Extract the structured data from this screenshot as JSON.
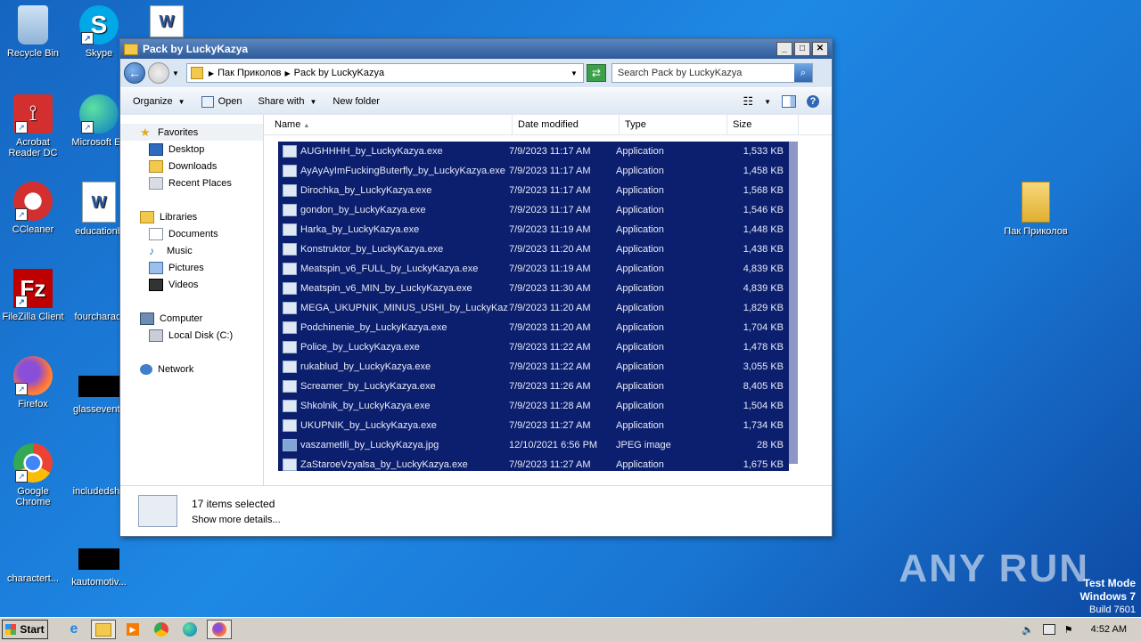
{
  "desktop": {
    "icons": [
      {
        "label": "Recycle Bin"
      },
      {
        "label": "Skype"
      },
      {
        "label": "Acrobat Reader DC"
      },
      {
        "label": "Microsoft Ed"
      },
      {
        "label": "CCleaner"
      },
      {
        "label": "educationb"
      },
      {
        "label": "FileZilla Client"
      },
      {
        "label": "fourcharact"
      },
      {
        "label": "Firefox"
      },
      {
        "label": "glassevents"
      },
      {
        "label": "Google Chrome"
      },
      {
        "label": "includedsha"
      },
      {
        "label": "charactert..."
      },
      {
        "label": "kautomotiv..."
      },
      {
        "label": "Пак Приколов"
      }
    ]
  },
  "window": {
    "title": "Pack by LuckyKazya",
    "address": {
      "segments": [
        "Пак Приколов",
        "Pack by LuckyKazya"
      ]
    },
    "search_placeholder": "Search Pack by LuckyKazya",
    "toolbar": {
      "organize": "Organize",
      "open": "Open",
      "share": "Share with",
      "new_folder": "New folder"
    },
    "nav": {
      "favorites": "Favorites",
      "desktop": "Desktop",
      "downloads": "Downloads",
      "recent": "Recent Places",
      "libraries": "Libraries",
      "documents": "Documents",
      "music": "Music",
      "pictures": "Pictures",
      "videos": "Videos",
      "computer": "Computer",
      "local_disk": "Local Disk (C:)",
      "network": "Network"
    },
    "columns": {
      "name": "Name",
      "date": "Date modified",
      "type": "Type",
      "size": "Size"
    },
    "files": [
      {
        "name": "AUGHHHH_by_LuckyKazya.exe",
        "date": "7/9/2023 11:17 AM",
        "type": "Application",
        "size": "1,533 KB"
      },
      {
        "name": "AyAyAyImFuckingButerfly_by_LuckyKazya.exe",
        "date": "7/9/2023 11:17 AM",
        "type": "Application",
        "size": "1,458 KB"
      },
      {
        "name": "Dirochka_by_LuckyKazya.exe",
        "date": "7/9/2023 11:17 AM",
        "type": "Application",
        "size": "1,568 KB"
      },
      {
        "name": "gondon_by_LuckyKazya.exe",
        "date": "7/9/2023 11:17 AM",
        "type": "Application",
        "size": "1,546 KB"
      },
      {
        "name": "Harka_by_LuckyKazya.exe",
        "date": "7/9/2023 11:19 AM",
        "type": "Application",
        "size": "1,448 KB"
      },
      {
        "name": "Konstruktor_by_LuckyKazya.exe",
        "date": "7/9/2023 11:20 AM",
        "type": "Application",
        "size": "1,438 KB"
      },
      {
        "name": "Meatspin_v6_FULL_by_LuckyKazya.exe",
        "date": "7/9/2023 11:19 AM",
        "type": "Application",
        "size": "4,839 KB"
      },
      {
        "name": "Meatspin_v6_MIN_by_LuckyKazya.exe",
        "date": "7/9/2023 11:30 AM",
        "type": "Application",
        "size": "4,839 KB"
      },
      {
        "name": "MEGA_UKUPNIK_MINUS_USHI_by_LuckyKaz...",
        "date": "7/9/2023 11:20 AM",
        "type": "Application",
        "size": "1,829 KB"
      },
      {
        "name": "Podchinenie_by_LuckyKazya.exe",
        "date": "7/9/2023 11:20 AM",
        "type": "Application",
        "size": "1,704 KB"
      },
      {
        "name": "Police_by_LuckyKazya.exe",
        "date": "7/9/2023 11:22 AM",
        "type": "Application",
        "size": "1,478 KB"
      },
      {
        "name": "rukablud_by_LuckyKazya.exe",
        "date": "7/9/2023 11:22 AM",
        "type": "Application",
        "size": "3,055 KB"
      },
      {
        "name": "Screamer_by_LuckyKazya.exe",
        "date": "7/9/2023 11:26 AM",
        "type": "Application",
        "size": "8,405 KB"
      },
      {
        "name": "Shkolnik_by_LuckyKazya.exe",
        "date": "7/9/2023 11:28 AM",
        "type": "Application",
        "size": "1,504 KB"
      },
      {
        "name": "UKUPNIK_by_LuckyKazya.exe",
        "date": "7/9/2023 11:27 AM",
        "type": "Application",
        "size": "1,734 KB"
      },
      {
        "name": "vaszametili_by_LuckyKazya.jpg",
        "date": "12/10/2021 6:56 PM",
        "type": "JPEG image",
        "size": "28 KB"
      },
      {
        "name": "ZaStaroeVzyalsa_by_LuckyKazya.exe",
        "date": "7/9/2023 11:27 AM",
        "type": "Application",
        "size": "1,675 KB"
      }
    ],
    "details": {
      "count": "17 items selected",
      "more": "Show more details..."
    }
  },
  "taskbar": {
    "start": "Start",
    "clock": "4:52 AM"
  },
  "watermark": {
    "text": "ANY RUN"
  },
  "testmode": {
    "line1": "Test Mode",
    "line2": "Windows 7",
    "line3": "Build 7601"
  }
}
